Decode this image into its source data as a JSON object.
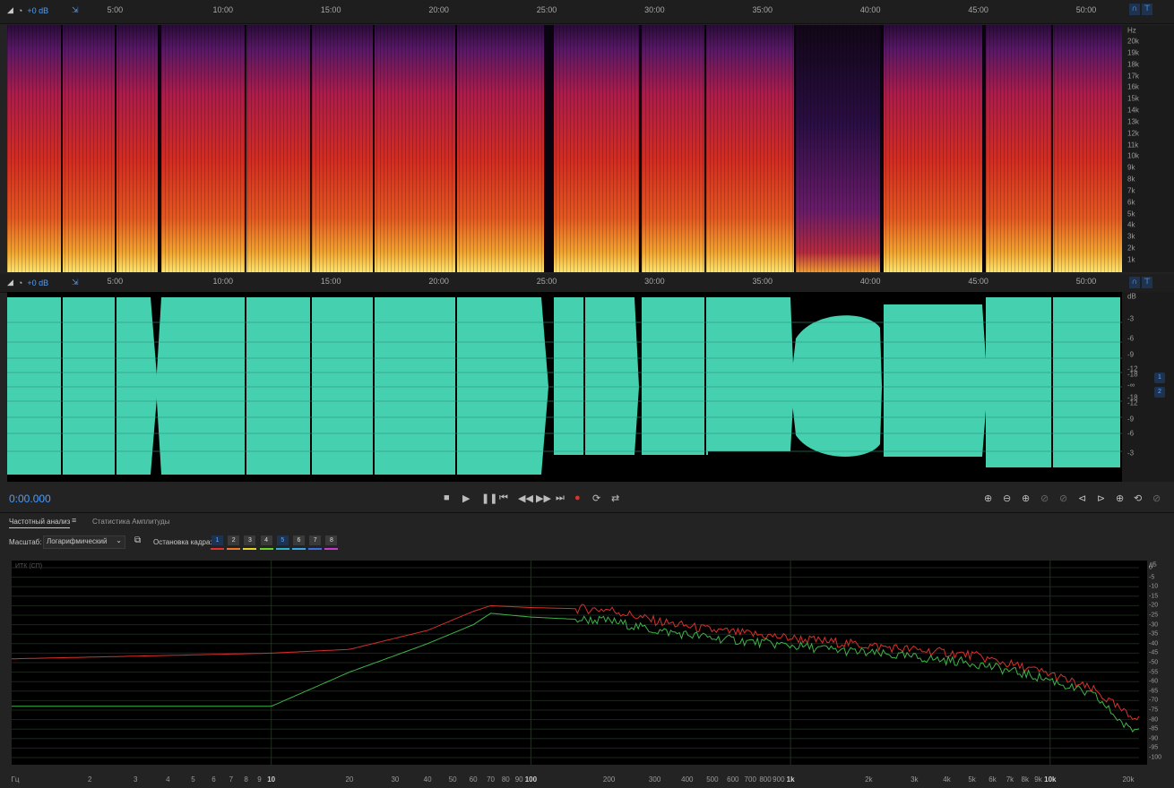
{
  "top_ruler": {
    "gain_label": "+0 dB",
    "time_ticks": [
      "5:00",
      "10:00",
      "15:00",
      "20:00",
      "25:00",
      "30:00",
      "35:00",
      "40:00",
      "45:00",
      "50:00"
    ]
  },
  "spectral": {
    "unit": "Hz",
    "freq_labels": [
      "20k",
      "19k",
      "18k",
      "17k",
      "16k",
      "15k",
      "14k",
      "13k",
      "12k",
      "11k",
      "10k",
      "9k",
      "8k",
      "7k",
      "6k",
      "5k",
      "4k",
      "3k",
      "2k",
      "1k"
    ]
  },
  "wave_ruler": {
    "gain_label": "+0 dB",
    "time_ticks": [
      "5:00",
      "10:00",
      "15:00",
      "20:00",
      "25:00",
      "30:00",
      "35:00",
      "40:00",
      "45:00",
      "50:00"
    ]
  },
  "waveform": {
    "unit": "dB",
    "db_labels": [
      "-3",
      "-6",
      "-9",
      "-12",
      "-18",
      "-∞",
      "-18",
      "-12",
      "-9",
      "-6",
      "-3"
    ],
    "channel_badges": [
      "1",
      "2"
    ],
    "colors": {
      "wave": "#45d1b0",
      "background": "#000000"
    }
  },
  "transport": {
    "time": "0:00.000",
    "icons": [
      "stop-icon",
      "play-icon",
      "pause-icon",
      "go-to-start-icon",
      "rewind-icon",
      "fast-forward-icon",
      "go-to-end-icon",
      "record-icon",
      "loop-icon",
      "skip-selection-icon"
    ]
  },
  "panel": {
    "tabs": [
      {
        "label": "Частотный анализ",
        "active": true
      },
      {
        "label": "Статистика Амплитуды",
        "active": false
      }
    ],
    "scale_label": "Масштаб:",
    "scale_value": "Логарифмический",
    "frame_label": "Остановка кадра:",
    "frame_buttons": [
      "1",
      "2",
      "3",
      "4",
      "5",
      "6",
      "7",
      "8"
    ],
    "frame_colors": [
      "#e0312d",
      "#e87b28",
      "#e5d12a",
      "#6ad02a",
      "#2fb0d0",
      "#3aa7e8",
      "#3f6de0",
      "#c43cc8"
    ]
  },
  "chart_data": {
    "type": "line",
    "title": "",
    "corner_label": "ИТК (СП)",
    "x_scale": "log",
    "xlabel": "Гц",
    "ylabel": "дБ",
    "x_tick_labels": [
      "Гц",
      "2",
      "3",
      "4",
      "5",
      "6",
      "7",
      "8",
      "9",
      "10",
      "20",
      "30",
      "40",
      "50",
      "60",
      "70",
      "80",
      "90",
      "100",
      "200",
      "300",
      "400",
      "500",
      "600",
      "700",
      "800",
      "900",
      "1k",
      "2k",
      "3k",
      "4k",
      "5k",
      "6k",
      "7k",
      "8k",
      "9k",
      "10k",
      "20k"
    ],
    "y_tick_labels": [
      "дБ",
      "0",
      "-5",
      "-10",
      "-15",
      "-20",
      "-25",
      "-30",
      "-35",
      "-40",
      "-45",
      "-50",
      "-55",
      "-60",
      "-65",
      "-70",
      "-75",
      "-80",
      "-85",
      "-90",
      "-95",
      "-100"
    ],
    "ylim": [
      -100,
      0
    ],
    "series": [
      {
        "color": "#d9302b",
        "x": [
          1,
          10,
          20,
          40,
          60,
          70,
          100,
          200,
          300,
          500,
          1000,
          2000,
          5000,
          10000,
          15000,
          20000
        ],
        "values": [
          -48,
          -45,
          -43,
          -33,
          -23,
          -20,
          -21,
          -22,
          -28,
          -33,
          -37,
          -41,
          -46,
          -56,
          -65,
          -78
        ]
      },
      {
        "color": "#3fb24a",
        "x": [
          1,
          10,
          20,
          40,
          60,
          70,
          100,
          200,
          300,
          500,
          1000,
          2000,
          5000,
          10000,
          15000,
          20000
        ],
        "values": [
          -73,
          -73,
          -55,
          -40,
          -30,
          -24,
          -26,
          -28,
          -33,
          -37,
          -41,
          -45,
          -50,
          -59,
          -68,
          -85
        ]
      }
    ]
  }
}
